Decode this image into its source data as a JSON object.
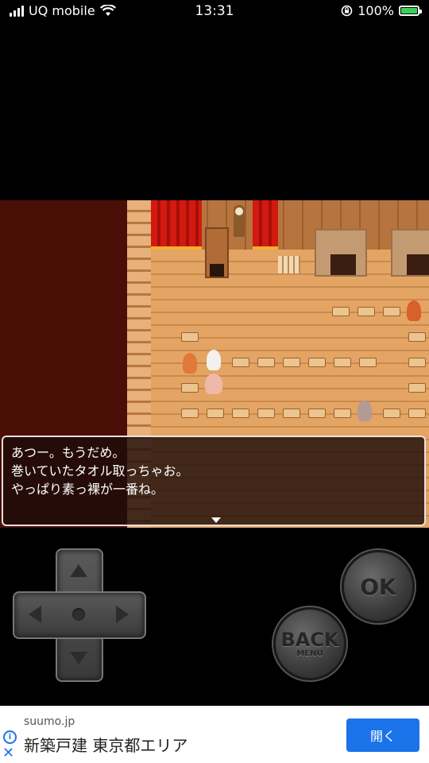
{
  "status_bar": {
    "carrier": "UQ mobile",
    "time": "13:31",
    "battery": "100%",
    "battery_level": 1.0
  },
  "dialog": {
    "lines": [
      "あつー。もうだめ。",
      "巻いていたタオル取っちゃお。",
      "やっぱり素っ裸が一番ね。"
    ]
  },
  "controls": {
    "ok_label": "OK",
    "back_label": "BACK",
    "back_sub_label": "MENU"
  },
  "ad": {
    "domain": "suumo.jp",
    "title": "新築戸建 東京都エリア",
    "open_label": "開く"
  },
  "colors": {
    "accent": "#1a73e8",
    "battery_green": "#39d353",
    "curtain_red": "#d21a10",
    "floor_wood": "#e4a463"
  }
}
